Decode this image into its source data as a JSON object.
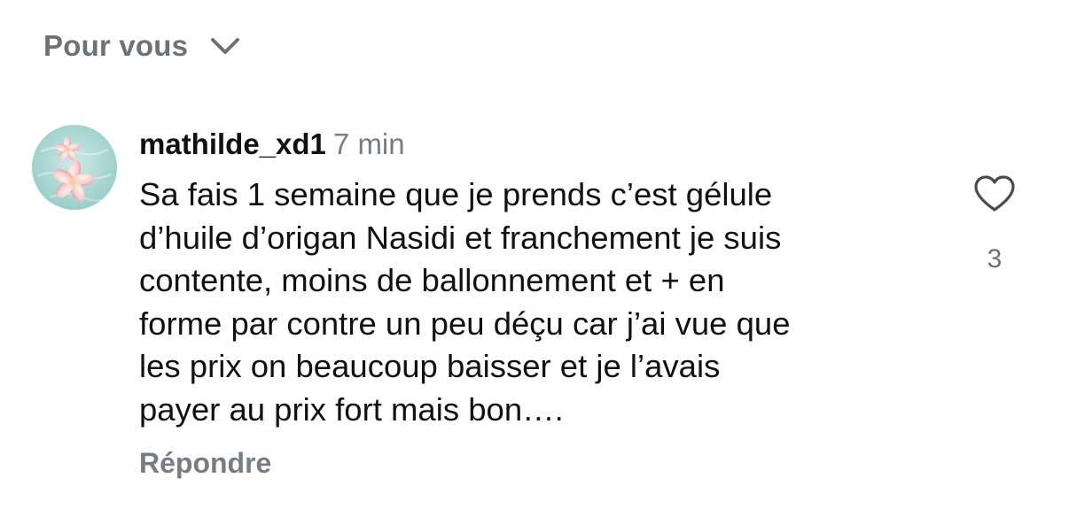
{
  "header": {
    "sort_label": "Pour vous",
    "sort_icon": "chevron-down-icon"
  },
  "comment": {
    "avatar_icon": "plumeria-flower-avatar",
    "username": "mathilde_xd1",
    "time": "7 min",
    "text": "Sa fais 1 semaine que je prends c’est gélule\nd’huile d’origan Nasidi et franchement je suis\ncontente, moins de ballonnement et + en\nforme par contre un peu déçu car j’ai vue que\nles prix on beaucoup baisser et je l’avais\npayer au prix fort mais bon….",
    "reply_label": "Répondre",
    "like_icon": "heart-icon",
    "like_count": "3"
  },
  "colors": {
    "text_primary": "#111111",
    "text_secondary": "#7b7c82",
    "background": "#ffffff"
  }
}
